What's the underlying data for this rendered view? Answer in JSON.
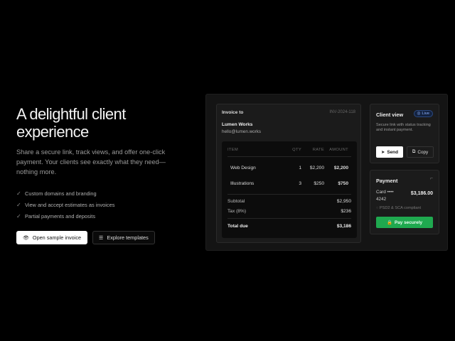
{
  "hero": {
    "title_line1": "A delightful client",
    "title_line2": "experience",
    "lead": "Share a secure link, track views, and offer one-click payment. Your clients see exactly what they need—nothing more.",
    "features": [
      "Custom domains and branding",
      "View and accept estimates as invoices",
      "Partial payments and deposits"
    ],
    "cta_primary": "Open sample invoice",
    "cta_secondary": "Explore templates"
  },
  "invoice": {
    "label": "Invoice to",
    "number": "INV-2024-118",
    "client_name": "Lumen Works",
    "client_email": "hello@lumen.works",
    "columns": {
      "item": "ITEM",
      "qty": "QTY",
      "rate": "RATE",
      "amount": "AMOUNT"
    },
    "rows": [
      {
        "item": "Web Design",
        "qty": "1",
        "rate": "$2,200",
        "amount": "$2,200"
      },
      {
        "item": "Illustrations",
        "qty": "3",
        "rate": "$250",
        "amount": "$750"
      }
    ],
    "subtotal_label": "Subtotal",
    "subtotal": "$2,950",
    "tax_label": "Tax (8%)",
    "tax": "$236",
    "total_label": "Total due",
    "total": "$3,186"
  },
  "client_view": {
    "title": "Client view",
    "badge": "Live",
    "description": "Secure link with status tracking and instant payment.",
    "send": "Send",
    "copy": "Copy"
  },
  "payment": {
    "title": "Payment",
    "card_label": "Card •••• 4242",
    "amount": "$3,186.00",
    "security": "PSD2 & SCA compliant",
    "pay_button": "Pay securely"
  },
  "colors": {
    "accent_green": "#1fa94f",
    "badge_blue": "#8fb4ff"
  }
}
